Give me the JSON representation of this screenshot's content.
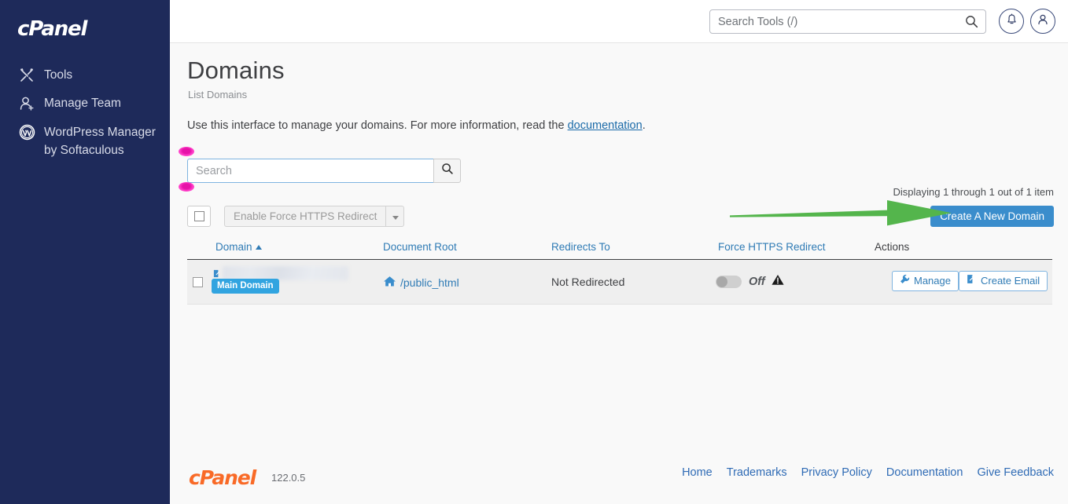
{
  "sidebar": {
    "brand": "cPanel",
    "items": [
      {
        "label": "Tools",
        "icon": "tools-icon"
      },
      {
        "label": "Manage Team",
        "icon": "team-icon"
      },
      {
        "label": "WordPress Manager by Softaculous",
        "icon": "wordpress-icon"
      }
    ]
  },
  "topbar": {
    "search_placeholder": "Search Tools (/)",
    "search_value": "",
    "notifications_icon": "bell-icon",
    "account_icon": "user-icon"
  },
  "page": {
    "title": "Domains",
    "breadcrumb": "List Domains",
    "intro_before": "Use this interface to manage your domains. For more information, read the ",
    "intro_link": "documentation",
    "intro_after": "."
  },
  "toolbar": {
    "search_placeholder": "Search",
    "search_value": "",
    "search_button_icon": "search-icon",
    "select_all_label": "",
    "https_button_label": "Enable Force HTTPS Redirect",
    "dropdown_caret_icon": "chevron-down-icon",
    "displaying": "Displaying 1 through 1 out of 1 item",
    "create_button_label": "Create A New Domain"
  },
  "table": {
    "headers": [
      {
        "label": "Domain",
        "sorted": "asc",
        "link": true
      },
      {
        "label": "Document Root",
        "link": true
      },
      {
        "label": "Redirects To",
        "link": true
      },
      {
        "label": "Force HTTPS Redirect",
        "link": true
      },
      {
        "label": "Actions",
        "link": false
      }
    ],
    "rows": [
      {
        "domain_redacted": true,
        "badge": "Main Domain",
        "document_root": "/public_html",
        "redirects_to": "Not Redirected",
        "force_https_state": "Off",
        "force_https_warning": true,
        "actions": [
          {
            "label": "Manage",
            "icon": "wrench-icon"
          },
          {
            "label": "Create Email",
            "icon": "external-link-icon"
          }
        ]
      }
    ]
  },
  "footer": {
    "logo": "cPanel",
    "version": "122.0.5",
    "links": [
      "Home",
      "Trademarks",
      "Privacy Policy",
      "Documentation",
      "Give Feedback"
    ]
  },
  "annotations": {
    "arrow_color": "#54b54c",
    "marker_color": "#e612a8",
    "accent_blue": "#3a8dcc",
    "sidebar_color": "#1e2a5a",
    "logo_orange": "#f96a27"
  }
}
